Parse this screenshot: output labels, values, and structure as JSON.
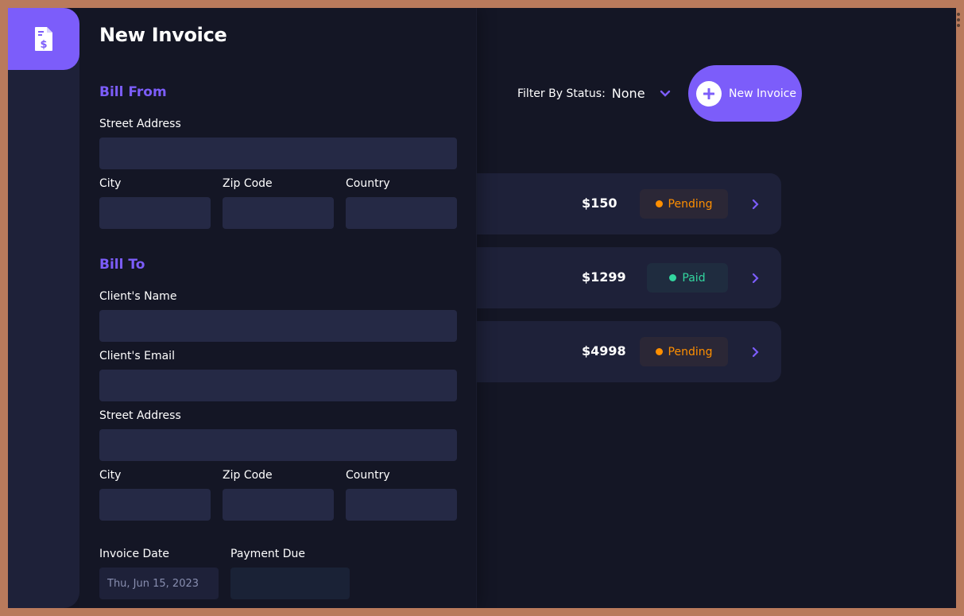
{
  "drawer": {
    "title": "New Invoice",
    "bill_from": {
      "heading": "Bill From",
      "street_label": "Street Address",
      "city_label": "City",
      "zip_label": "Zip Code",
      "country_label": "Country",
      "street_value": "",
      "city_value": "",
      "zip_value": "",
      "country_value": ""
    },
    "bill_to": {
      "heading": "Bill To",
      "name_label": "Client's Name",
      "email_label": "Client's Email",
      "street_label": "Street Address",
      "city_label": "City",
      "zip_label": "Zip Code",
      "country_label": "Country",
      "name_value": "",
      "email_value": "",
      "street_value": "",
      "city_value": "",
      "zip_value": "",
      "country_value": ""
    },
    "invoice_date_label": "Invoice Date",
    "invoice_date_value": "Thu, Jun 15, 2023",
    "payment_due_label": "Payment Due",
    "payment_due_value": ""
  },
  "toolbar": {
    "filter_label": "Filter By Status:",
    "filter_value": "None",
    "new_invoice_label": "New Invoice"
  },
  "invoices": [
    {
      "amount": "$150",
      "status": "Pending"
    },
    {
      "amount": "$1299",
      "status": "Paid"
    },
    {
      "amount": "$4998",
      "status": "Pending"
    }
  ],
  "colors": {
    "accent": "#7c5dfa",
    "background": "#141625",
    "surface": "#1e2139",
    "input": "#252945",
    "pending": "#ff8f00",
    "paid": "#33d69f",
    "frame": "#b97a5c"
  },
  "icons": {
    "logo": "invoice-document-icon",
    "new_invoice": "plus-icon",
    "filter": "chevron-down-icon",
    "row_arrow": "chevron-right-icon"
  }
}
